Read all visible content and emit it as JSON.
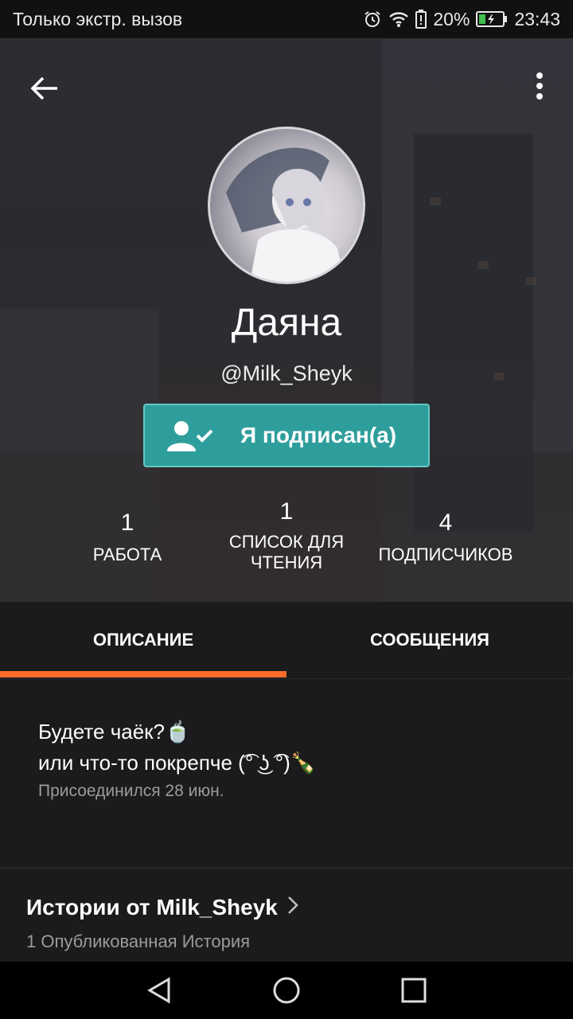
{
  "status_bar": {
    "carrier": "Только экстр. вызов",
    "battery": "20%",
    "time": "23:43"
  },
  "profile": {
    "name": "Даяна",
    "handle": "@Milk_Sheyk",
    "follow_label": "Я подписан(а)"
  },
  "stats": [
    {
      "value": "1",
      "label": "РАБОТА"
    },
    {
      "value": "1",
      "label": "СПИСОК ДЛЯ ЧТЕНИЯ"
    },
    {
      "value": "4",
      "label": "ПОДПИСЧИКОВ"
    }
  ],
  "tabs": [
    {
      "label": "ОПИСАНИЕ",
      "active": true
    },
    {
      "label": "СООБЩЕНИЯ",
      "active": false
    }
  ],
  "about": {
    "line1": "Будете чаёк?🍵",
    "line2": "или что-то покрепче (͡° ͜ʖ ͡°)🍾",
    "joined": "Присоединился 28 июн."
  },
  "stories": {
    "title": "Истории от Milk_Sheyk",
    "count": "1 Опубликованная История"
  },
  "colors": {
    "accent": "#ff6a2b",
    "follow_button": "#2e9e9c"
  },
  "icons": [
    "alarm-icon",
    "wifi-icon",
    "battery-alert-icon",
    "battery-charging-icon",
    "back-arrow-icon",
    "more-vert-icon",
    "user-check-icon",
    "chevron-right-icon",
    "nav-back-icon",
    "nav-home-icon",
    "nav-recents-icon"
  ]
}
